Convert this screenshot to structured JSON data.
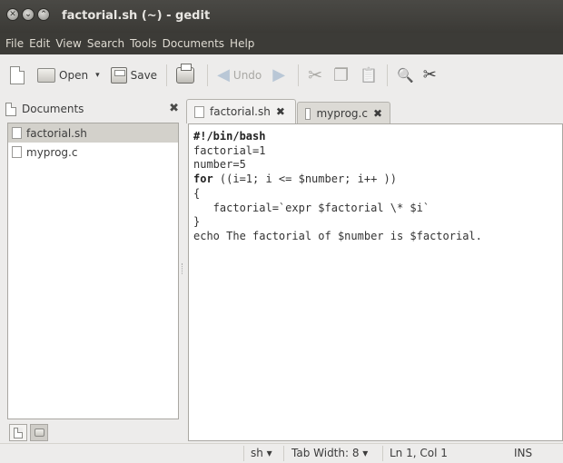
{
  "window": {
    "title": "factorial.sh (~) - gedit",
    "close_glyph": "✕",
    "min_glyph": "⌄",
    "max_glyph": "⌃"
  },
  "menu": [
    "File",
    "Edit",
    "View",
    "Search",
    "Tools",
    "Documents",
    "Help"
  ],
  "toolbar": {
    "open_label": "Open",
    "open_arrow": "▾",
    "save_label": "Save",
    "undo_label": "Undo",
    "undo_glyph": "◀",
    "redo_glyph": "▶",
    "cut_glyph": "✂",
    "copy_glyph": "❐",
    "paste_glyph": "📋",
    "find_glyph": "🔍",
    "replace_glyph": "✂"
  },
  "side_panel": {
    "title": "Documents",
    "close_glyph": "✖",
    "files": [
      "factorial.sh",
      "myprog.c"
    ]
  },
  "tabs": [
    {
      "label": "factorial.sh",
      "close": "✖"
    },
    {
      "label": "myprog.c",
      "close": "✖"
    }
  ],
  "editor": {
    "lines": [
      "#!/bin/bash",
      "",
      "factorial=1",
      "number=5",
      "",
      "for ((i=1; i <= $number; i++ ))",
      "{",
      "   factorial=`expr $factorial \\* $i`",
      "}",
      "",
      "echo The factorial of $number is $factorial."
    ]
  },
  "status": {
    "language": "sh ▾",
    "tab_width": "Tab Width:  8 ▾",
    "position": "Ln 1, Col 1",
    "mode": "INS"
  }
}
